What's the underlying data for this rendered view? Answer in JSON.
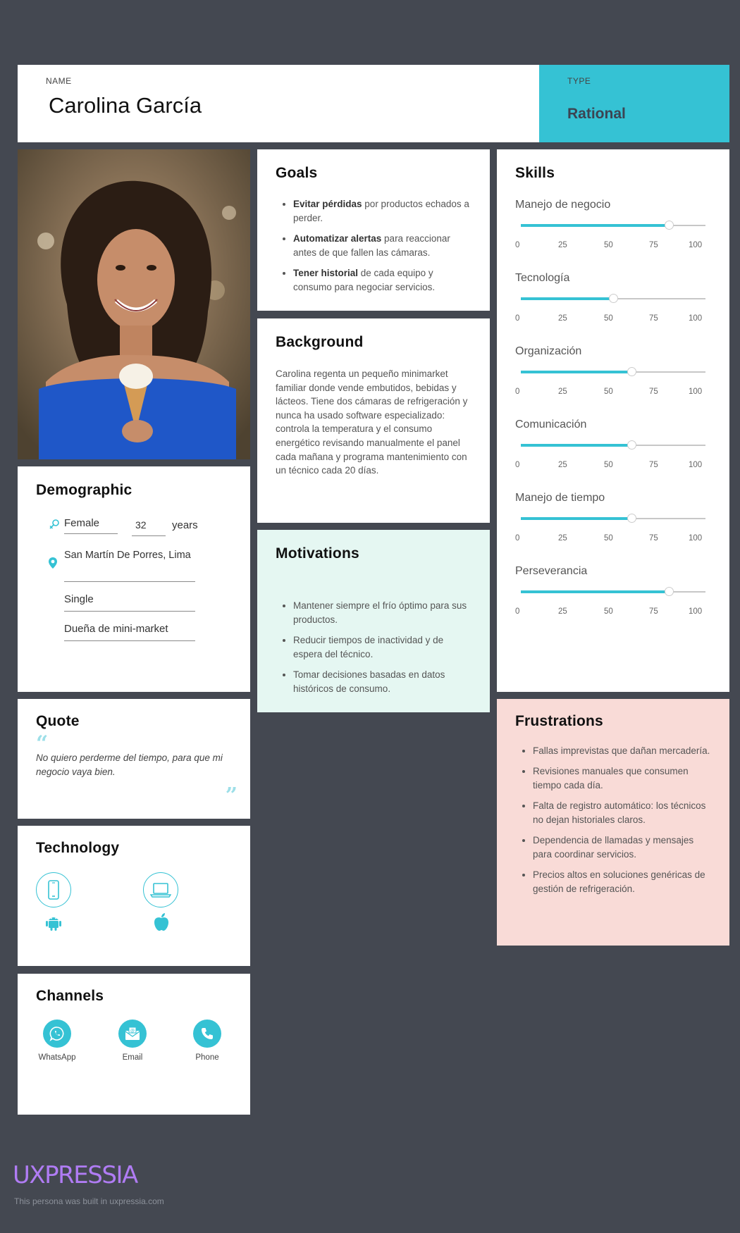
{
  "header": {
    "name_label": "NAME",
    "name": "Carolina García",
    "type_label": "TYPE",
    "type": "Rational"
  },
  "goals": {
    "title": "Goals",
    "items": [
      {
        "bold": "Evitar pérdidas",
        "rest": " por productos echados a perder."
      },
      {
        "bold": "Automatizar alertas",
        "rest": " para reaccionar antes de que fallen las cámaras."
      },
      {
        "bold": "Tener historial",
        "rest": " de cada equipo y consumo para negociar servicios."
      }
    ]
  },
  "background": {
    "title": "Background",
    "text": "Carolina regenta un pequeño minimarket familiar donde vende embutidos, bebidas y lácteos. Tiene dos cámaras de refrigeración y nunca ha usado software especializado: controla la temperatura y el consumo energético revisando manualmente el panel cada mañana y programa mantenimiento con un técnico cada 20 días."
  },
  "motivations": {
    "title": "Motivations",
    "items": [
      "Mantener siempre el frío óptimo para sus productos.",
      "Reducir tiempos de inactividad y de espera del técnico.",
      "Tomar decisiones basadas en datos históricos de consumo."
    ]
  },
  "skills": {
    "title": "Skills",
    "ticks": [
      "0",
      "25",
      "50",
      "75",
      "100"
    ],
    "items": [
      {
        "label": "Manejo de negocio",
        "value": 80
      },
      {
        "label": "Tecnología",
        "value": 50
      },
      {
        "label": "Organización",
        "value": 60
      },
      {
        "label": "Comunicación",
        "value": 60
      },
      {
        "label": "Manejo de tiempo",
        "value": 60
      },
      {
        "label": "Perseverancia",
        "value": 80
      }
    ]
  },
  "demographic": {
    "title": "Demographic",
    "gender": "Female",
    "age": "32",
    "age_unit": "years",
    "location": "San Martín De Porres, Lima",
    "status": "Single",
    "occupation": "Dueña de mini-market"
  },
  "quote": {
    "title": "Quote",
    "text": "No quiero perderme del tiempo, para que mi negocio vaya bien."
  },
  "technology": {
    "title": "Technology",
    "devices": [
      "smartphone-icon",
      "laptop-icon"
    ],
    "platforms": [
      "android-icon",
      "apple-icon"
    ]
  },
  "channels": {
    "title": "Channels",
    "items": [
      "WhatsApp",
      "Email",
      "Phone"
    ]
  },
  "frustrations": {
    "title": "Frustrations",
    "items": [
      "Fallas imprevistas que dañan mercadería.",
      "Revisiones manuales que consumen tiempo cada día.",
      "Falta de registro automático: los técnicos no dejan historiales claros.",
      "Dependencia de llamadas y mensajes para coordinar servicios.",
      "Precios altos en soluciones genéricas de gestión de refrigeración."
    ]
  },
  "footer": {
    "logo": "UXPRESSIA",
    "built": "This persona was built in uxpressia.com"
  },
  "colors": {
    "accent": "#35c2d4",
    "background": "#444851",
    "motivations_bg": "#e5f7f2",
    "frustrations_bg": "#f9dbd7",
    "logo": "#b07cf4"
  }
}
